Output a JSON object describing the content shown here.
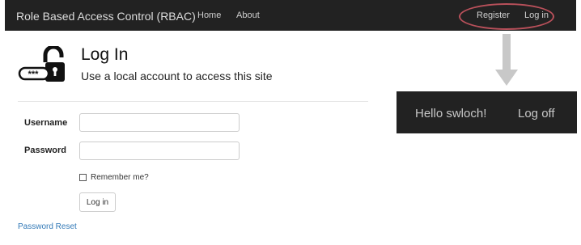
{
  "navbar": {
    "brand": "Role Based Access Control (RBAC)",
    "links": [
      "Home",
      "About"
    ],
    "right_links": [
      "Register",
      "Log in"
    ],
    "highlight_color": "#b8505a"
  },
  "preview_bar": {
    "greeting": "Hello swloch!",
    "logoff": "Log off"
  },
  "header": {
    "icon": "padlock-password-icon",
    "title": "Log In",
    "subtitle": "Use a local account to access this site",
    "icon_text": "***"
  },
  "form": {
    "username_label": "Username",
    "password_label": "Password",
    "username_value": "",
    "password_value": "",
    "remember_label": "Remember me?",
    "remember_checked": false,
    "submit_label": "Log in"
  },
  "footer": {
    "reset_link": "Password Reset",
    "link_color": "#337ab7"
  },
  "arrow_color": "#c8c8c8"
}
